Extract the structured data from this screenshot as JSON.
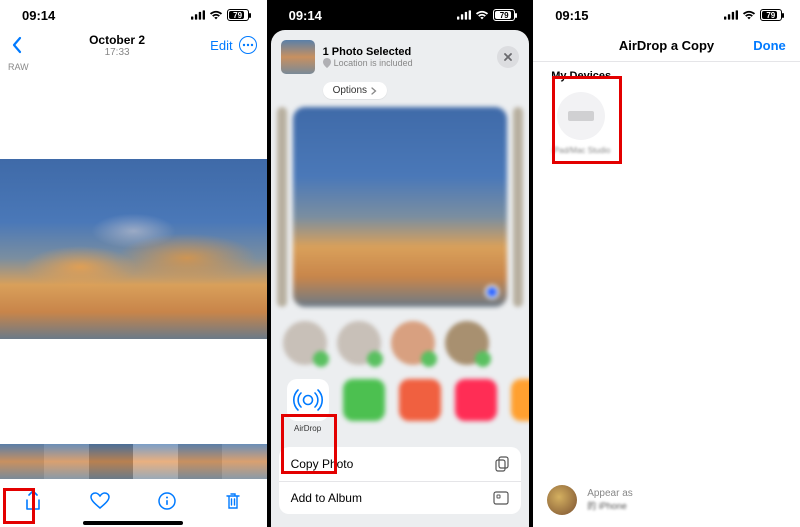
{
  "phone1": {
    "status": {
      "time": "09:14",
      "battery": "79"
    },
    "nav": {
      "date": "October 2",
      "time": "17:33",
      "edit": "Edit"
    },
    "badge": "RAW",
    "toolbar_icons": [
      "share",
      "heart",
      "info",
      "trash"
    ]
  },
  "phone2": {
    "status": {
      "time": "09:14",
      "battery": "79"
    },
    "header": {
      "title": "1 Photo Selected",
      "subtitle": "Location is included",
      "options": "Options"
    },
    "airdrop_label": "AirDrop",
    "actions": [
      {
        "label": "Copy Photo",
        "icon": "copy"
      },
      {
        "label": "Add to Album",
        "icon": "album"
      }
    ]
  },
  "phone3": {
    "status": {
      "time": "09:15",
      "battery": "79"
    },
    "nav": {
      "title": "AirDrop a Copy",
      "done": "Done"
    },
    "section_title": "My Devices",
    "device_label": "iPad/Mac Studio",
    "appear": {
      "label": "Appear as",
      "value": "的 iPhone"
    }
  }
}
